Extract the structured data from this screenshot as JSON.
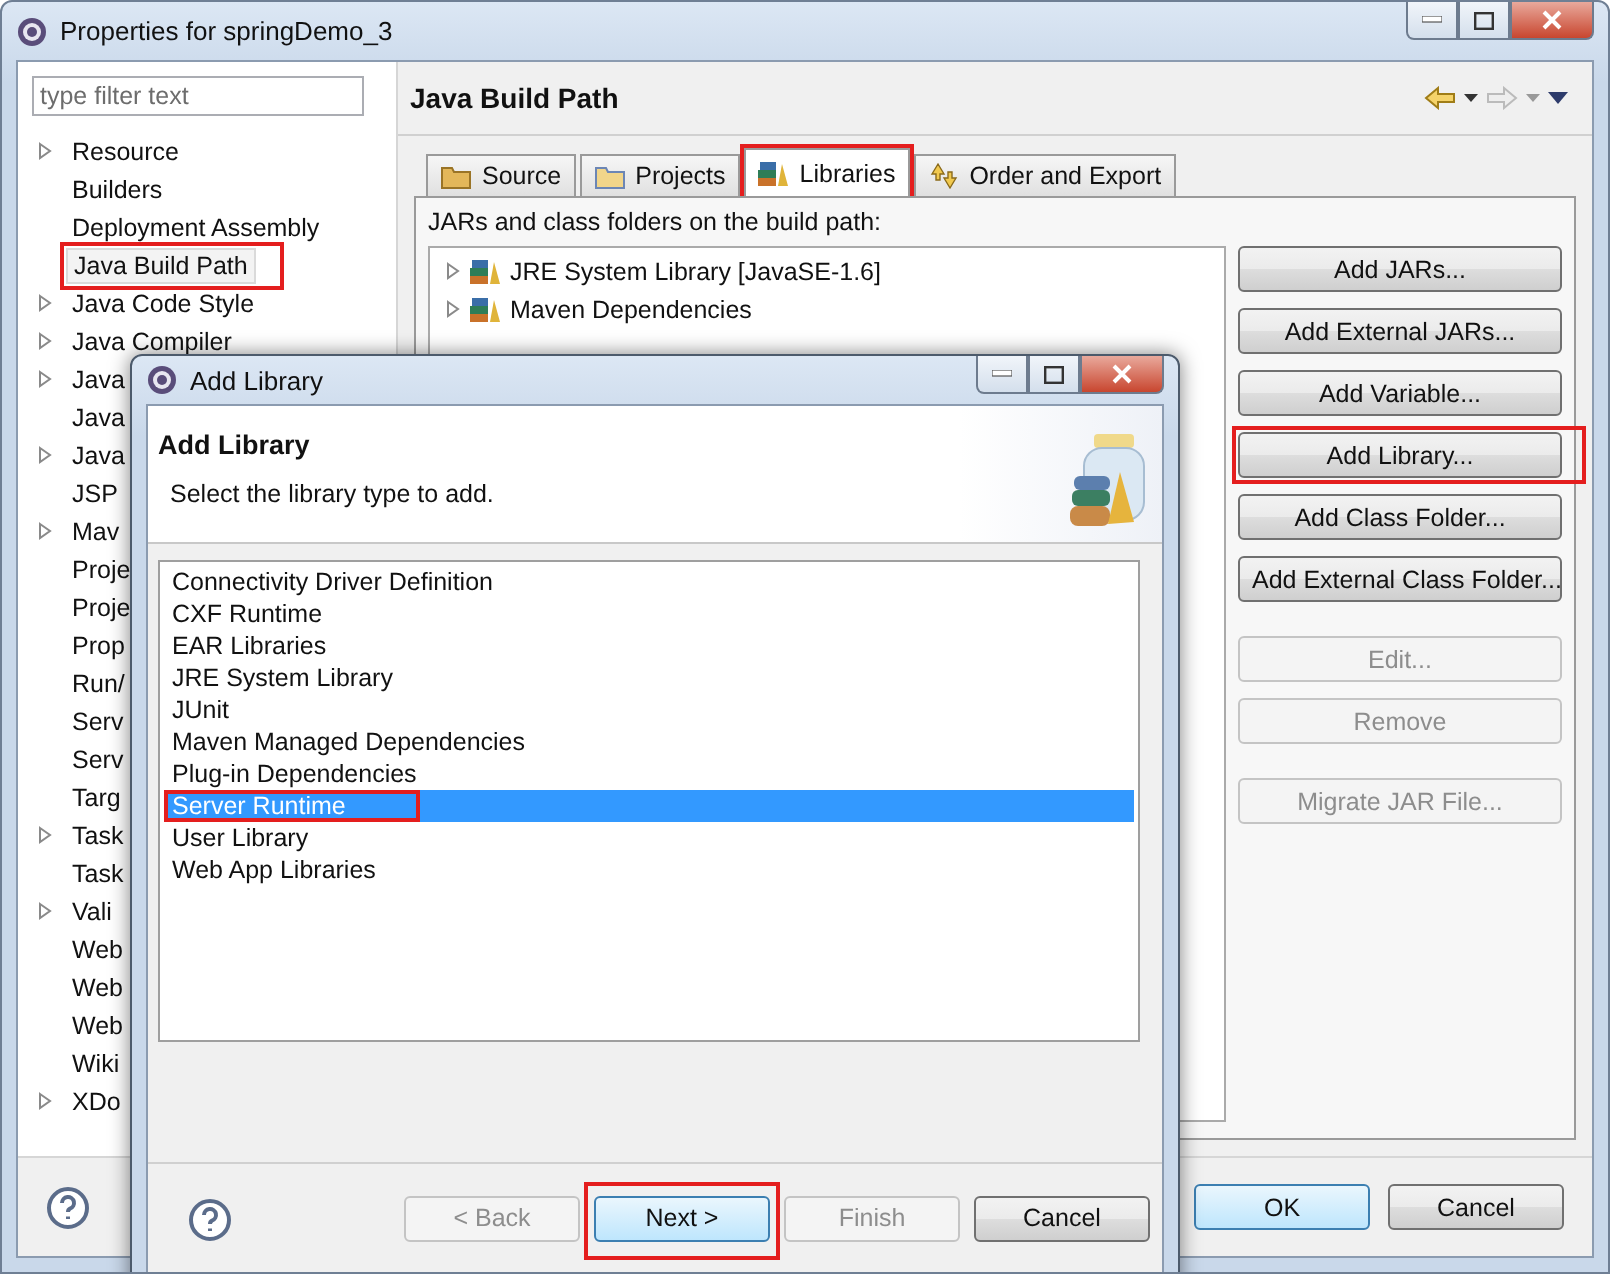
{
  "window": {
    "title": "Properties for springDemo_3"
  },
  "filter": {
    "placeholder": "type filter text"
  },
  "sidebar": {
    "items": [
      {
        "label": "Resource",
        "expandable": true,
        "selected": false,
        "highlighted": false
      },
      {
        "label": "Builders",
        "expandable": false,
        "selected": false,
        "highlighted": false
      },
      {
        "label": "Deployment Assembly",
        "expandable": false,
        "selected": false,
        "highlighted": false
      },
      {
        "label": "Java Build Path",
        "expandable": false,
        "selected": true,
        "highlighted": true
      },
      {
        "label": "Java Code Style",
        "expandable": true,
        "selected": false,
        "highlighted": false
      },
      {
        "label": "Java Compiler",
        "expandable": true,
        "selected": false,
        "highlighted": false
      },
      {
        "label": "Java",
        "expandable": true,
        "selected": false,
        "highlighted": false
      },
      {
        "label": "Java",
        "expandable": false,
        "selected": false,
        "highlighted": false
      },
      {
        "label": "Java",
        "expandable": true,
        "selected": false,
        "highlighted": false
      },
      {
        "label": "JSP",
        "expandable": false,
        "selected": false,
        "highlighted": false
      },
      {
        "label": "Mav",
        "expandable": true,
        "selected": false,
        "highlighted": false
      },
      {
        "label": "Proje",
        "expandable": false,
        "selected": false,
        "highlighted": false
      },
      {
        "label": "Proje",
        "expandable": false,
        "selected": false,
        "highlighted": false
      },
      {
        "label": "Prop",
        "expandable": false,
        "selected": false,
        "highlighted": false
      },
      {
        "label": "Run/",
        "expandable": false,
        "selected": false,
        "highlighted": false
      },
      {
        "label": "Serv",
        "expandable": false,
        "selected": false,
        "highlighted": false
      },
      {
        "label": "Serv",
        "expandable": false,
        "selected": false,
        "highlighted": false
      },
      {
        "label": "Targ",
        "expandable": false,
        "selected": false,
        "highlighted": false
      },
      {
        "label": "Task",
        "expandable": true,
        "selected": false,
        "highlighted": false
      },
      {
        "label": "Task",
        "expandable": false,
        "selected": false,
        "highlighted": false
      },
      {
        "label": "Vali",
        "expandable": true,
        "selected": false,
        "highlighted": false
      },
      {
        "label": "Web",
        "expandable": false,
        "selected": false,
        "highlighted": false
      },
      {
        "label": "Web",
        "expandable": false,
        "selected": false,
        "highlighted": false
      },
      {
        "label": "Web",
        "expandable": false,
        "selected": false,
        "highlighted": false
      },
      {
        "label": "Wiki",
        "expandable": false,
        "selected": false,
        "highlighted": false
      },
      {
        "label": "XDo",
        "expandable": true,
        "selected": false,
        "highlighted": false
      }
    ]
  },
  "page": {
    "title": "Java Build Path"
  },
  "tabs": [
    {
      "label": "Source",
      "selected": false,
      "highlighted": false
    },
    {
      "label": "Projects",
      "selected": false,
      "highlighted": false
    },
    {
      "label": "Libraries",
      "selected": true,
      "highlighted": true
    },
    {
      "label": "Order and Export",
      "selected": false,
      "highlighted": false
    }
  ],
  "libraries": {
    "caption": "JARs and class folders on the build path:",
    "entries": [
      {
        "label": "JRE System Library [JavaSE-1.6]"
      },
      {
        "label": "Maven Dependencies"
      }
    ]
  },
  "side_button_groups": [
    {
      "buttons": [
        {
          "label": "Add JARs...",
          "disabled": false,
          "highlighted": false
        },
        {
          "label": "Add External JARs...",
          "disabled": false,
          "highlighted": false
        },
        {
          "label": "Add Variable...",
          "disabled": false,
          "highlighted": false
        },
        {
          "label": "Add Library...",
          "disabled": false,
          "highlighted": true
        },
        {
          "label": "Add Class Folder...",
          "disabled": false,
          "highlighted": false
        },
        {
          "label": "Add External Class Folder...",
          "disabled": false,
          "highlighted": false
        }
      ]
    },
    {
      "buttons": [
        {
          "label": "Edit...",
          "disabled": true,
          "highlighted": false
        },
        {
          "label": "Remove",
          "disabled": true,
          "highlighted": false
        }
      ]
    },
    {
      "buttons": [
        {
          "label": "Migrate JAR File...",
          "disabled": true,
          "highlighted": false
        }
      ]
    }
  ],
  "footer": {
    "buttons": [
      {
        "label": "OK",
        "default": true
      },
      {
        "label": "Cancel",
        "default": false
      }
    ]
  },
  "dialog": {
    "title": "Add Library",
    "heading": "Add Library",
    "description": "Select the library type to add.",
    "types": [
      {
        "label": "Connectivity Driver Definition",
        "selected": false,
        "highlighted": false
      },
      {
        "label": "CXF Runtime",
        "selected": false,
        "highlighted": false
      },
      {
        "label": "EAR Libraries",
        "selected": false,
        "highlighted": false
      },
      {
        "label": "JRE System Library",
        "selected": false,
        "highlighted": false
      },
      {
        "label": "JUnit",
        "selected": false,
        "highlighted": false
      },
      {
        "label": "Maven Managed Dependencies",
        "selected": false,
        "highlighted": false
      },
      {
        "label": "Plug-in Dependencies",
        "selected": false,
        "highlighted": false
      },
      {
        "label": "Server Runtime",
        "selected": true,
        "highlighted": true
      },
      {
        "label": "User Library",
        "selected": false,
        "highlighted": false
      },
      {
        "label": "Web App Libraries",
        "selected": false,
        "highlighted": false
      }
    ],
    "buttons": [
      {
        "label": "< Back",
        "disabled": true,
        "default": false,
        "highlighted": false
      },
      {
        "label": "Next >",
        "disabled": false,
        "default": true,
        "highlighted": true
      },
      {
        "label": "Finish",
        "disabled": true,
        "default": false,
        "highlighted": false
      },
      {
        "label": "Cancel",
        "disabled": false,
        "default": false,
        "highlighted": false
      }
    ]
  }
}
